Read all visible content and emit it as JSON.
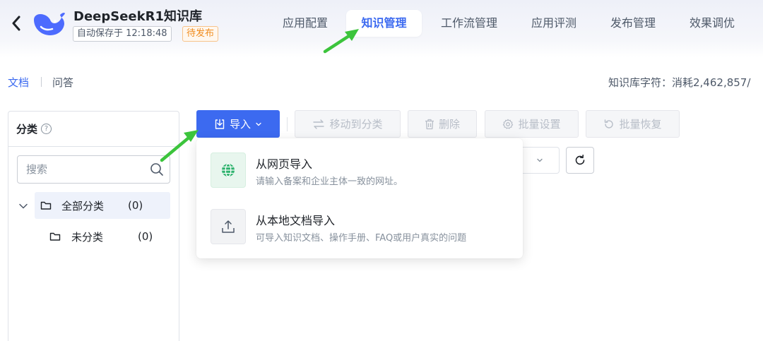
{
  "header": {
    "app_title": "DeepSeekR1知识库",
    "autosave": "自动保存于 12:18:48",
    "status": "待发布",
    "tabs": [
      {
        "label": "应用配置"
      },
      {
        "label": "知识管理"
      },
      {
        "label": "工作流管理"
      },
      {
        "label": "应用评测"
      },
      {
        "label": "发布管理"
      },
      {
        "label": "效果调优"
      }
    ],
    "active_tab": "知识管理"
  },
  "subtabs": {
    "items": [
      {
        "label": "文档"
      },
      {
        "label": "问答"
      }
    ],
    "active": "文档"
  },
  "quota": "知识库字符：消耗2,462,857/",
  "category_panel": {
    "title": "分类",
    "help_glyph": "?",
    "search_placeholder": "搜索",
    "tree": [
      {
        "label": "全部分类",
        "count": "(0)"
      },
      {
        "label": "未分类",
        "count": "(0)"
      }
    ]
  },
  "toolbar": {
    "import": "导入",
    "move": "移动到分类",
    "delete": "删除",
    "batch_settings": "批量设置",
    "batch_restore": "批量恢复"
  },
  "import_menu": [
    {
      "title": "从网页导入",
      "desc": "请输入备案和企业主体一致的网址。",
      "icon": "globe-icon"
    },
    {
      "title": "从本地文档导入",
      "desc": "可导入知识文档、操作手册、FAQ或用户真实的问题",
      "icon": "upload-icon"
    }
  ],
  "colors": {
    "primary": "#3c6af0",
    "status_orange": "#f08c1f",
    "annotation_green": "#3cc43c",
    "globe_green": "#2fb36e"
  }
}
